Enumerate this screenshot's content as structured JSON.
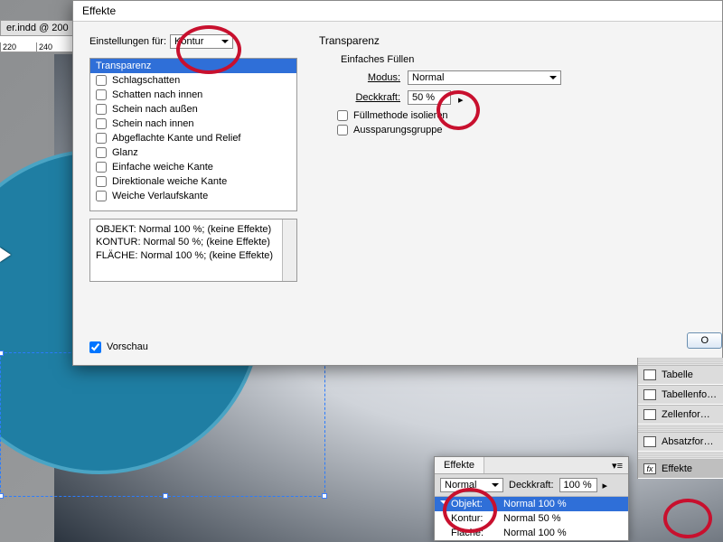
{
  "doc_tab": "er.indd @ 200",
  "ruler_marks": [
    "220",
    "240"
  ],
  "dialog": {
    "title": "Effekte",
    "settings_label": "Einstellungen für:",
    "settings_value": "Kontur",
    "effects": [
      "Transparenz",
      "Schlagschatten",
      "Schatten nach innen",
      "Schein nach außen",
      "Schein nach innen",
      "Abgeflachte Kante und Relief",
      "Glanz",
      "Einfache weiche Kante",
      "Direktionale weiche Kante",
      "Weiche Verlaufskante"
    ],
    "summary": [
      "OBJEKT: Normal 100 %; (keine Effekte)",
      "KONTUR: Normal 50 %; (keine Effekte)",
      "FLÄCHE: Normal 100 %; (keine Effekte)"
    ],
    "preview_label": "Vorschau",
    "section_title": "Transparenz",
    "group_title": "Einfaches Füllen",
    "mode_label": "Modus:",
    "mode_value": "Normal",
    "opacity_label": "Deckkraft:",
    "opacity_value": "50 %",
    "chk1": "Füllmethode isolieren",
    "chk2": "Aussparungsgruppe",
    "ok": "O"
  },
  "panels": {
    "items": [
      "Tabelle",
      "Tabellenfo…",
      "Zellenfor…",
      "Absatzfor…",
      "Effekte"
    ]
  },
  "fx_panel": {
    "title": "Effekte",
    "mode": "Normal",
    "opacity_label": "Deckkraft:",
    "opacity_value": "100 %",
    "rows": [
      {
        "label": "Objekt:",
        "value": "Normal 100 %"
      },
      {
        "label": "Kontur:",
        "value": "Normal 50 %"
      },
      {
        "label": "Fläche:",
        "value": "Normal 100 %"
      }
    ]
  }
}
